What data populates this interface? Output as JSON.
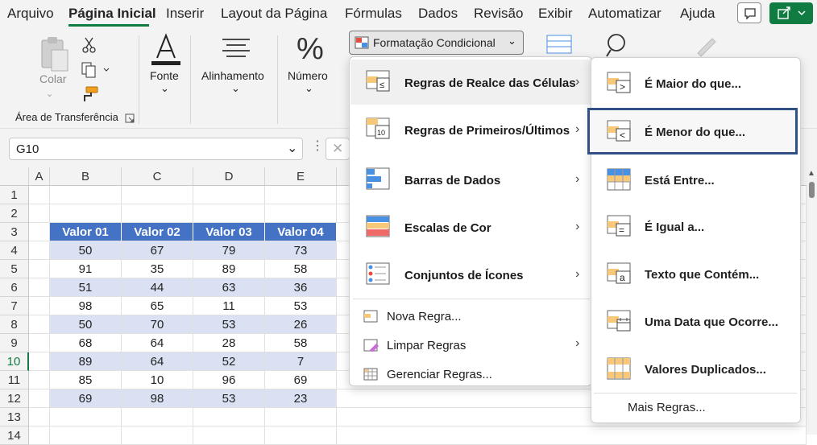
{
  "menu": {
    "tabs": [
      "Arquivo",
      "Página Inicial",
      "Inserir",
      "Layout da Página",
      "Fórmulas",
      "Dados",
      "Revisão",
      "Exibir",
      "Automatizar",
      "Ajuda"
    ],
    "active": "Página Inicial"
  },
  "ribbon": {
    "paste_label": "Colar",
    "clipboard_group": "Área de Transferência",
    "font_label": "Fonte",
    "align_label": "Alinhamento",
    "number_label": "Número",
    "cond_format_label": "Formatação Condicional"
  },
  "formula": {
    "namebox": "G10"
  },
  "grid": {
    "columns": [
      "A",
      "B",
      "C",
      "D",
      "E"
    ],
    "rows": [
      "1",
      "2",
      "3",
      "4",
      "5",
      "6",
      "7",
      "8",
      "9",
      "10",
      "11",
      "12",
      "13",
      "14"
    ],
    "headers": [
      "Valor 01",
      "Valor 02",
      "Valor 03",
      "Valor 04"
    ],
    "data": [
      [
        50,
        67,
        79,
        73
      ],
      [
        91,
        35,
        89,
        58
      ],
      [
        51,
        44,
        63,
        36
      ],
      [
        98,
        65,
        11,
        53
      ],
      [
        50,
        70,
        53,
        26
      ],
      [
        68,
        64,
        28,
        58
      ],
      [
        89,
        64,
        52,
        7
      ],
      [
        85,
        10,
        96,
        69
      ],
      [
        69,
        98,
        53,
        23
      ]
    ]
  },
  "menu1": {
    "items": [
      "Regras de Realce das Células",
      "Regras de Primeiros/Últimos",
      "Barras de Dados",
      "Escalas de Cor",
      "Conjuntos de Ícones"
    ],
    "simple": [
      "Nova Regra...",
      "Limpar Regras",
      "Gerenciar Regras..."
    ]
  },
  "menu2": {
    "items": [
      "É Maior do que...",
      "É Menor do que...",
      "Está Entre...",
      "É Igual a...",
      "Texto que Contém...",
      "Uma Data que Ocorre...",
      "Valores Duplicados..."
    ],
    "more": "Mais Regras..."
  },
  "colors": {
    "accent": "#107c41",
    "table_header": "#4472c4",
    "band": "#d9e1f2",
    "highlight_border": "#2f4f86"
  }
}
